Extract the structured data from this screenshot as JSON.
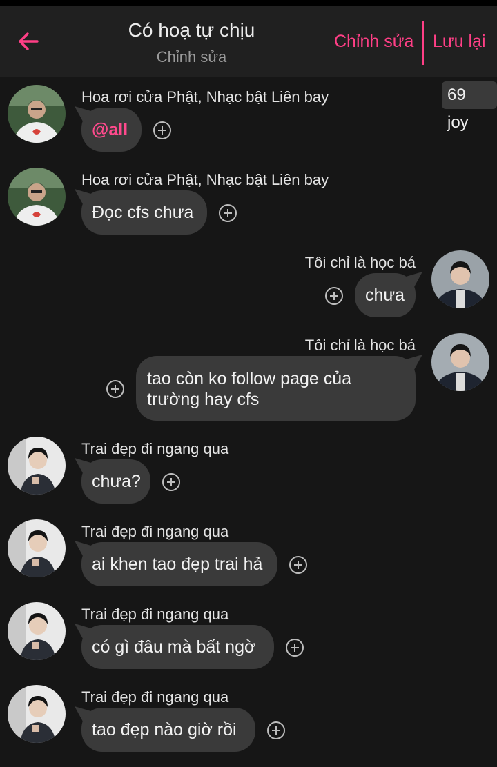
{
  "header": {
    "title": "Có hoạ tự chịu",
    "subtitle": "Chỉnh sửa",
    "edit_label": "Chỉnh sửa",
    "save_label": "Lưu lại",
    "accent_color": "#ff3f86",
    "back_icon": "arrow-left-icon"
  },
  "badge": "69 joy",
  "messages": [
    {
      "sender": "Hoa rơi cửa Phật, Nhạc bật Liên bay",
      "text": "@all",
      "side": "left"
    },
    {
      "sender": "Hoa rơi cửa Phật, Nhạc bật Liên bay",
      "text": "Đọc cfs chưa",
      "side": "left"
    },
    {
      "sender": "Tôi chỉ là học bá",
      "text": "chưa",
      "side": "right"
    },
    {
      "sender": "Tôi chỉ là học bá",
      "text_line1": "tao còn ko follow page của",
      "text_line2": "trường hay cfs",
      "side": "right"
    },
    {
      "sender": "Trai đẹp đi ngang qua",
      "text": "chưa?",
      "side": "left"
    },
    {
      "sender": "Trai đẹp đi ngang qua",
      "text": "ai khen tao đẹp trai hả",
      "side": "left"
    },
    {
      "sender": "Trai đẹp đi ngang qua",
      "text": "có gì đâu mà bất ngờ",
      "side": "left"
    },
    {
      "sender": "Trai đẹp đi ngang qua",
      "text": "tao đẹp nào giờ rồi",
      "side": "left"
    }
  ],
  "icons": {
    "react": "add-reaction-icon"
  }
}
